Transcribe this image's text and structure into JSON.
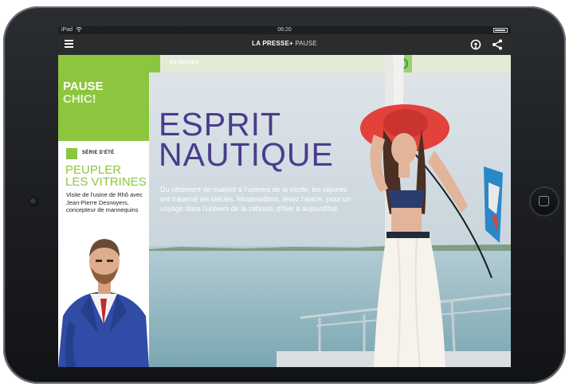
{
  "status": {
    "device": "iPad",
    "time": "06:20"
  },
  "appbar": {
    "brand_bold": "LA PRESSE+",
    "brand_section": "PAUSE"
  },
  "left": {
    "section_line1": "PAUSE",
    "section_line2": "CHIC!",
    "series_label": "SÉRIE D'ÉTÉ",
    "article_title_line1": "PEUPLER",
    "article_title_line2": "LES VITRINES",
    "article_desc": "Visite de l'usine de Rhô avec Jean-Pierre Desnoyers, concepteur de mannequins"
  },
  "hero": {
    "tag": "EN IMAGES",
    "title_line1": "ESPRIT",
    "title_line2": "NAUTIQUE",
    "description": "Du vêtement de matelot à l'univers de la mode, les rayures ont traversé les siècles. Moussaillons, levez l'ancre, pour un voyage dans l'univers de la zébrure, d'hier à aujourd'hui."
  },
  "colors": {
    "accent_green": "#8cc63e",
    "title_purple": "#4a3c8c",
    "appbar": "#2b2c2e"
  },
  "icons": [
    "menu-icon",
    "chevron-down-icon",
    "podcast-icon",
    "share-icon",
    "wifi-icon",
    "battery-icon"
  ]
}
